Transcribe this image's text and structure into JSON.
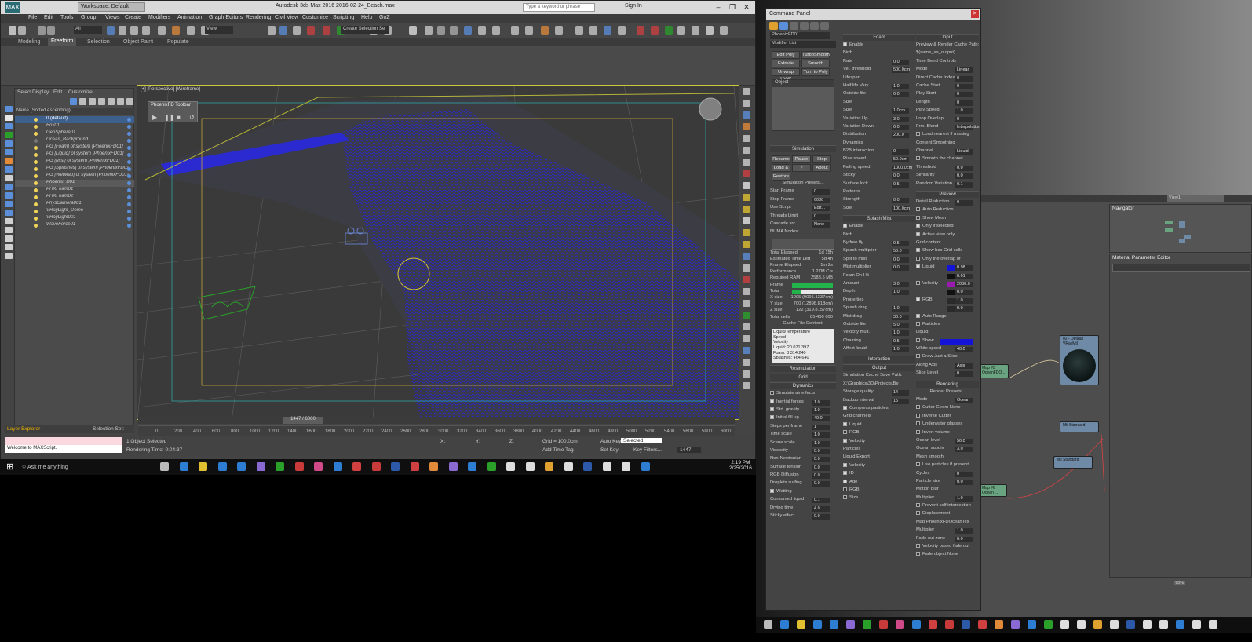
{
  "max": {
    "logo": "MAX",
    "workspace": "Workspace: Default",
    "title": "Autodesk 3ds Max 2016      2016-02-24_Beach.max",
    "search_placeholder": "Type a keyword or phrase",
    "signin": "Sign In",
    "menu": [
      "File",
      "Edit",
      "Tools",
      "Group",
      "Views",
      "Create",
      "Modifiers",
      "Animation",
      "Graph Editors",
      "Rendering",
      "Civil View",
      "Customize",
      "Scripting",
      "Help",
      "GoZ"
    ],
    "toolbar": {
      "filter": "All",
      "view": "View",
      "selset": "Create Selection Se"
    },
    "ribbon_tabs": [
      "Modeling",
      "Freeform",
      "Selection",
      "Object Paint",
      "Populate"
    ],
    "scene_menu": [
      "Select",
      "Display",
      "Edit",
      "Customize"
    ],
    "scene_header": "Name (Sorted Ascending)",
    "scene_items": [
      {
        "name": "0 (default)",
        "state": "sel"
      },
      {
        "name": "Box01",
        "state": ""
      },
      {
        "name": "GeoSphere01",
        "state": ""
      },
      {
        "name": "Ocean_Background",
        "state": "off"
      },
      {
        "name": "PG [Foam] of system [PhoenixFD01]",
        "state": ""
      },
      {
        "name": "PG [Liquid] of system [PhoenixFD01]",
        "state": ""
      },
      {
        "name": "PG [Mist] of system [PhoenixFD01]",
        "state": ""
      },
      {
        "name": "PG [Splashes] of system [PhoenixFD01]",
        "state": ""
      },
      {
        "name": "PG [WetMap] of system [PhoenixFD01]",
        "state": ""
      },
      {
        "name": "PhoenixFD01",
        "state": "hl"
      },
      {
        "name": "PHXFoam01",
        "state": ""
      },
      {
        "name": "PHXFoam02",
        "state": ""
      },
      {
        "name": "PhysCamera001",
        "state": ""
      },
      {
        "name": "VRayLight_Dome",
        "state": ""
      },
      {
        "name": "VRayLight001",
        "state": ""
      },
      {
        "name": "WaveForce01",
        "state": ""
      }
    ],
    "layer_explorer": "Layer Explorer",
    "selection_set": "Selection Set:",
    "viewport_label": "[+] [Perspective] [Wireframe]",
    "pfd_toolbar": "PhoenixFD Toolbar",
    "timeslider": "1447 / 6000",
    "ruler": [
      "0",
      "200",
      "400",
      "600",
      "800",
      "1000",
      "1200",
      "1400",
      "1600",
      "1800",
      "2000",
      "2200",
      "2400",
      "2600",
      "2800",
      "3000",
      "3200",
      "3400",
      "3600",
      "3800",
      "4000",
      "4200",
      "4400",
      "4600",
      "4800",
      "5000",
      "5200",
      "5400",
      "5600",
      "5800",
      "6000"
    ],
    "status_selected": "1 Object Selected",
    "status_render": "Rendering Time: 0:04:37",
    "maxscript": "Welcome to MAXScript.",
    "coord_x": "X:",
    "coord_y": "Y:",
    "coord_z": "Z:",
    "grid": "Grid = 100.0cm",
    "add_time_tag": "Add Time Tag",
    "auto_key": "Auto Key",
    "set_key": "Set Key",
    "selected": "Selected",
    "key_filters": "Key Filters...",
    "frame": "1447"
  },
  "taskbar": {
    "search": "Ask me anything",
    "time": "2:19 PM",
    "date": "2/25/2016"
  },
  "cmd": {
    "title": "Command Panel",
    "object_name": "PhoenixFD01",
    "modifier_list": "Modifier List",
    "mod_buttons": [
      "Edit Poly",
      "TurboSmooth",
      "Extrude",
      "Smooth",
      "Unwrap UVW",
      "Turn to Poly"
    ],
    "stack": "Object",
    "sim_title": "Simulation",
    "sim_buttons": [
      "Resume",
      "Pause",
      "Stop",
      "Load & Start",
      "?",
      "About",
      "Restore"
    ],
    "sim_presets": "Simulation Presets...",
    "sim_rows": [
      {
        "label": "Start Frame",
        "value": "0"
      },
      {
        "label": "Stop Frame",
        "value": "6000"
      },
      {
        "label": "Use Script",
        "value": "Edit..."
      },
      {
        "label": "Threads Limit",
        "value": "0"
      },
      {
        "label": "Cascade src.",
        "value": "None"
      }
    ],
    "numa": "NUMA Nodes:",
    "stats": [
      {
        "label": "Total Elapsed",
        "value": "1d 15h"
      },
      {
        "label": "Estimated Time Left",
        "value": "5d 4h"
      },
      {
        "label": "Frame Elapsed",
        "value": "1m 2s"
      },
      {
        "label": "Performance",
        "value": "1.27M C/s"
      },
      {
        "label": "Required RAM",
        "value": "2583.5 MB"
      },
      {
        "label": "Frame",
        "value": ""
      },
      {
        "label": "Total",
        "value": ""
      },
      {
        "label": "X size",
        "value": "1005 (9095.1337cm)"
      },
      {
        "label": "Y size",
        "value": "700 (12898.818cm)"
      },
      {
        "label": "Z size",
        "value": "122 (319.8157cm)"
      },
      {
        "label": "Total cells",
        "value": "85 400 000"
      }
    ],
    "cache_title": "Cache File Content:",
    "cache_lines": [
      "Liquid/Temperature",
      "Speed",
      "Velocity",
      "Liquid: 20 071 397",
      "Foam: 3 314 240",
      "Splashes: 464 640"
    ],
    "resim": "Resimulation",
    "grid": "Grid",
    "dyn_title": "Dynamics",
    "dyn_rows": [
      {
        "label": "Simulate air effects",
        "value": "",
        "cb": "off"
      },
      {
        "label": "Inertial forces",
        "value": "1.0",
        "cb": "on"
      },
      {
        "label": "Std. gravity",
        "value": "1.0",
        "cb": "on"
      },
      {
        "label": "Initial fill up",
        "value": "40.0",
        "cb": "on"
      },
      {
        "label": "Steps per frame",
        "value": "1",
        "cb": ""
      },
      {
        "label": "Time scale",
        "value": "1.0",
        "cb": ""
      },
      {
        "label": "Scene scale",
        "value": "1.0",
        "cb": ""
      },
      {
        "label": "Viscosity",
        "value": "0.0",
        "cb": ""
      },
      {
        "label": "Non-Newtonian",
        "value": "0.0",
        "cb": ""
      },
      {
        "label": "Surface tension",
        "value": "0.0",
        "cb": ""
      },
      {
        "label": "RGB Diffusion",
        "value": "0.0",
        "cb": ""
      },
      {
        "label": "Droplets surfing",
        "value": "0.0",
        "cb": ""
      },
      {
        "label": "Wetting",
        "value": "",
        "cb": "on"
      },
      {
        "label": "Consumed liquid",
        "value": "0.1",
        "cb": ""
      },
      {
        "label": "Drying time",
        "value": "4.0",
        "cb": ""
      },
      {
        "label": "Sticky effect",
        "value": "0.0",
        "cb": ""
      }
    ],
    "foam_title": "Foam",
    "foam_rows": [
      {
        "label": "Enable",
        "value": "",
        "cb": "on"
      },
      {
        "label": "Birth",
        "value": "",
        "cb": ""
      },
      {
        "label": "Rate",
        "value": "0.0",
        "cb": ""
      },
      {
        "label": "Vel. threshold",
        "value": "500.0cm",
        "cb": ""
      },
      {
        "label": "Lifespan",
        "value": "",
        "cb": ""
      },
      {
        "label": "Half life      Vary",
        "value": "1.0",
        "cb": ""
      },
      {
        "label": "Outside life",
        "value": "0.0",
        "cb": ""
      },
      {
        "label": "Size",
        "value": "",
        "cb": ""
      },
      {
        "label": "Size",
        "value": "1.0cm",
        "cb": ""
      },
      {
        "label": "Variation Up",
        "value": "3.0",
        "cb": ""
      },
      {
        "label": "Variation Down",
        "value": "0.0",
        "cb": ""
      },
      {
        "label": "Distribution",
        "value": "200.0",
        "cb": ""
      },
      {
        "label": "Dynamics",
        "value": "",
        "cb": ""
      },
      {
        "label": "B2B interaction",
        "value": "0",
        "cb": ""
      },
      {
        "label": "Rise speed",
        "value": "50.0cm",
        "cb": ""
      },
      {
        "label": "Falling speed",
        "value": "1000.0cm",
        "cb": ""
      },
      {
        "label": "Sticky",
        "value": "0.0",
        "cb": ""
      },
      {
        "label": "Surface lock",
        "value": "0.5",
        "cb": ""
      },
      {
        "label": "Patterns",
        "value": "",
        "cb": ""
      },
      {
        "label": "Strength",
        "value": "0.0",
        "cb": ""
      },
      {
        "label": "Size",
        "value": "100.0cm",
        "cb": ""
      }
    ],
    "splash_title": "Splash/Mist",
    "splash_rows": [
      {
        "label": "Enable",
        "value": "",
        "cb": "on"
      },
      {
        "label": "Birth",
        "value": "",
        "cb": ""
      },
      {
        "label": "By free fly",
        "value": "0.5",
        "cb": ""
      },
      {
        "label": "Splash multiplier",
        "value": "50.0",
        "cb": ""
      },
      {
        "label": "Split to mist",
        "value": "0.0",
        "cb": ""
      },
      {
        "label": "Mist multiplier",
        "value": "0.0",
        "cb": ""
      },
      {
        "label": "Foam On Hit",
        "value": "",
        "cb": ""
      },
      {
        "label": "Amount",
        "value": "3.0",
        "cb": ""
      },
      {
        "label": "Depth",
        "value": "1.0",
        "cb": ""
      },
      {
        "label": "Properties",
        "value": "",
        "cb": ""
      },
      {
        "label": "Splash drag",
        "value": "1.0",
        "cb": ""
      },
      {
        "label": "Mist drag",
        "value": "30.0",
        "cb": ""
      },
      {
        "label": "Outside life",
        "value": "5.0",
        "cb": ""
      },
      {
        "label": "Velocity mult.",
        "value": "1.0",
        "cb": ""
      },
      {
        "label": "Chaining",
        "value": "0.5",
        "cb": ""
      },
      {
        "label": "Affect liquid",
        "value": "1.0",
        "cb": ""
      }
    ],
    "interaction": "Interaction",
    "output_title": "Output",
    "output_rows": [
      {
        "label": "Simulation Cache Save Path:",
        "value": "",
        "cb": ""
      },
      {
        "label": "X:\\Graphics\\3D\\Projects\\Be",
        "value": "",
        "cb": ""
      },
      {
        "label": "Storage quality",
        "value": "14",
        "cb": ""
      },
      {
        "label": "Backup interval",
        "value": "15",
        "cb": ""
      },
      {
        "label": "Compress particles",
        "value": "",
        "cb": "on"
      },
      {
        "label": "Grid channels",
        "value": "",
        "cb": ""
      },
      {
        "label": "Liquid",
        "value": "",
        "cb": "on"
      },
      {
        "label": "RGB",
        "value": "",
        "cb": "off"
      },
      {
        "label": "Velocity",
        "value": "",
        "cb": "on"
      },
      {
        "label": "Particles",
        "value": "",
        "cb": ""
      },
      {
        "label": "Liquid          Export",
        "value": "",
        "cb": ""
      },
      {
        "label": "Velocity",
        "value": "",
        "cb": "on"
      },
      {
        "label": "ID",
        "value": "",
        "cb": "on"
      },
      {
        "label": "Age",
        "value": "",
        "cb": "on"
      },
      {
        "label": "RGB",
        "value": "",
        "cb": "off"
      },
      {
        "label": "Size",
        "value": "",
        "cb": "off"
      }
    ],
    "input_title": "Input",
    "input_rows": [
      {
        "label": "Preview & Render Cache Path:",
        "value": "",
        "cb": ""
      },
      {
        "label": "$(same_as_output)",
        "value": "",
        "cb": ""
      },
      {
        "label": "Time Bend Controls",
        "value": "",
        "cb": ""
      },
      {
        "label": "Mode",
        "value": "Linear",
        "cb": ""
      },
      {
        "label": "Direct Cache Index",
        "value": "0",
        "cb": ""
      },
      {
        "label": "Cache Start",
        "value": "0",
        "cb": ""
      },
      {
        "label": "Play Start",
        "value": "0",
        "cb": ""
      },
      {
        "label": "Length",
        "value": "0",
        "cb": ""
      },
      {
        "label": "Play Speed",
        "value": "1.0",
        "cb": ""
      },
      {
        "label": "Loop Overlap",
        "value": "0",
        "cb": ""
      },
      {
        "label": "Frm. Blend",
        "value": "Interpolation",
        "cb": ""
      },
      {
        "label": "Load nearest if missing",
        "value": "",
        "cb": "off"
      },
      {
        "label": "Content Smoothing",
        "value": "",
        "cb": ""
      },
      {
        "label": "Channel",
        "value": "Liquid",
        "cb": ""
      },
      {
        "label": "Smooth the channel",
        "value": "",
        "cb": "off"
      },
      {
        "label": "Threshold",
        "value": "0.0",
        "cb": ""
      },
      {
        "label": "Similarity",
        "value": "0.0",
        "cb": ""
      },
      {
        "label": "Random Variation",
        "value": "0.1",
        "cb": ""
      }
    ],
    "preview_title": "Preview",
    "preview_rows": [
      {
        "label": "Detail Reduction",
        "value": "0",
        "cb": ""
      },
      {
        "label": "Auto Reduction",
        "value": "",
        "cb": "off"
      },
      {
        "label": "Show Mesh",
        "value": "",
        "cb": "off"
      },
      {
        "label": "Only if selected",
        "value": "",
        "cb": "on"
      },
      {
        "label": "Active view only",
        "value": "",
        "cb": "on"
      },
      {
        "label": "Grid content",
        "value": "",
        "cb": ""
      },
      {
        "label": "Show box      Grid cells",
        "value": "",
        "cb": "on"
      },
      {
        "label": "Only the overlap of",
        "value": "",
        "cb": "off"
      },
      {
        "label": "Liquid",
        "value": "0.98",
        "cb": "on"
      },
      {
        "label": "",
        "value": "0.01",
        "cb": ""
      },
      {
        "label": "Velocity",
        "value": "2000.0",
        "cb": "off"
      },
      {
        "label": "",
        "value": "0.0",
        "cb": ""
      },
      {
        "label": "RGB",
        "value": "1.0",
        "cb": "on"
      },
      {
        "label": "",
        "value": "0.0",
        "cb": ""
      },
      {
        "label": "Auto Range",
        "value": "",
        "cb": "on"
      }
    ],
    "particles_rows": [
      {
        "label": "Particles",
        "value": "",
        "cb": "off"
      },
      {
        "label": "Liquid",
        "value": "",
        "cb": ""
      },
      {
        "label": "Show",
        "value": "",
        "cb": "off"
      },
      {
        "label": "White speed",
        "value": "40.0",
        "cb": ""
      },
      {
        "label": "Draw Just a Slice",
        "value": "",
        "cb": "off"
      },
      {
        "label": "Along Axis",
        "value": "Axis",
        "cb": ""
      },
      {
        "label": "Slice Level",
        "value": "0",
        "cb": ""
      }
    ],
    "rendering_title": "Rendering",
    "render_presets": "Render Presets...",
    "render_rows": [
      {
        "label": "Mode",
        "value": "Ocean",
        "cb": ""
      },
      {
        "label": "Cutter Geom      None",
        "value": "",
        "cb": "off"
      },
      {
        "label": "Inverse Cutter",
        "value": "",
        "cb": "off"
      },
      {
        "label": "Underwater glasses",
        "value": "",
        "cb": "off"
      },
      {
        "label": "Invert volume",
        "value": "",
        "cb": "off"
      },
      {
        "label": "Ocean level",
        "value": "50.0",
        "cb": ""
      },
      {
        "label": "Ocean subdiv.",
        "value": "3.0",
        "cb": ""
      },
      {
        "label": "Mesh smooth",
        "value": "",
        "cb": ""
      },
      {
        "label": "Use particles if present",
        "value": "",
        "cb": "off"
      },
      {
        "label": "Cycles",
        "value": "0",
        "cb": ""
      },
      {
        "label": "Particle size",
        "value": "0.0",
        "cb": ""
      },
      {
        "label": "Motion blur",
        "value": "",
        "cb": ""
      },
      {
        "label": "Multiplier",
        "value": "1.0",
        "cb": ""
      },
      {
        "label": "Prevent self intersection",
        "value": "",
        "cb": "off"
      },
      {
        "label": "Displacement",
        "value": "",
        "cb": "off"
      },
      {
        "label": "Map      PhoenixFDOceanTex",
        "value": "",
        "cb": ""
      },
      {
        "label": "Multiplier",
        "value": "1.0",
        "cb": ""
      },
      {
        "label": "Fade out zone",
        "value": "0.0",
        "cb": ""
      },
      {
        "label": "Velocity based fade out",
        "value": "",
        "cb": "off"
      },
      {
        "label": "Fade object      None",
        "value": "",
        "cb": "off"
      }
    ]
  },
  "slate": {
    "view": "View1",
    "navigator": "Navigator",
    "matparam": "Material Parameter Editor",
    "nodes": [
      {
        "label": "Map #5 OceanFDO...",
        "kind": "green"
      },
      {
        "label": "02 - Default VRayMtl",
        "kind": "blue"
      },
      {
        "label": "Mtl Standard",
        "kind": "blue"
      },
      {
        "label": "Mtl Standard",
        "kind": "blue"
      },
      {
        "label": "Map #6 OceanT...",
        "kind": "green"
      }
    ],
    "zoom": "73%"
  },
  "colors": {
    "accent": "#2c5fa8",
    "wire": "#1818c8",
    "foam_green": "#22b34a",
    "selected": "#3c5f8c"
  }
}
